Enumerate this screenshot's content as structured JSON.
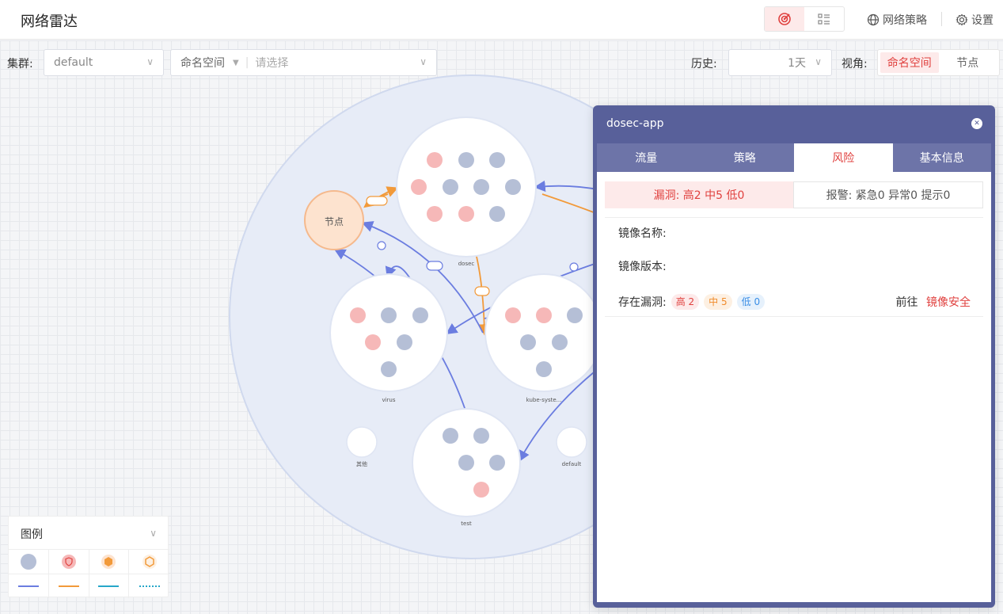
{
  "header": {
    "title": "网络雷达",
    "network_policy": "网络策略",
    "settings": "设置"
  },
  "filters": {
    "cluster_label": "集群:",
    "cluster_value": "default",
    "namespace_label": "命名空间",
    "namespace_placeholder": "请选择",
    "history_label": "历史:",
    "history_value": "1天",
    "view_label": "视角:",
    "view_options": [
      "命名空间",
      "节点"
    ]
  },
  "graph": {
    "node_label": "节点",
    "groups": [
      "dosec",
      "virus",
      "kube-syste...",
      "test",
      "其他",
      "default"
    ]
  },
  "legend": {
    "title": "图例"
  },
  "panel": {
    "title": "dosec-app",
    "tabs": [
      "流量",
      "策略",
      "风险",
      "基本信息"
    ],
    "risk_vuln": "漏洞: 高2 中5 低0",
    "risk_alarm": "报警: 紧急0 异常0 提示0",
    "image_name_label": "镜像名称:",
    "image_version_label": "镜像版本:",
    "vuln_label": "存在漏洞:",
    "tag_high": "高 2",
    "tag_mid": "中 5",
    "tag_low": "低 0",
    "goto_label": "前往",
    "goto_link": "镜像安全"
  },
  "colors": {
    "accent": "#e0413f",
    "panel_bg": "#58609a",
    "pod_gray": "#b5bfd6",
    "risk_pod": "#f6b8b8",
    "edge_blue": "#6b7de0",
    "edge_orange": "#f29a3a",
    "cluster_fill": "#e7ecf7",
    "node_orange": "#fde3cf"
  }
}
